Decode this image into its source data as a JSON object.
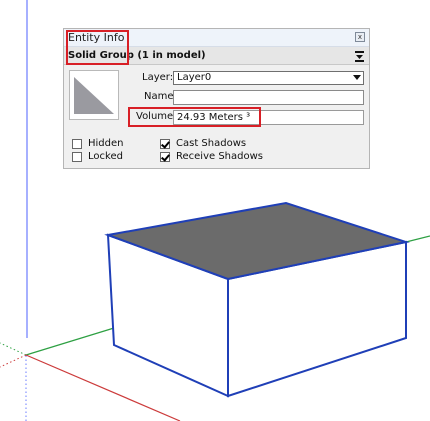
{
  "panel": {
    "title": "Entity Info",
    "entity_type": "Solid Group",
    "entity_count": " (1 in model)",
    "layer_label": "Layer:",
    "layer_value": "Layer0",
    "name_label": "Name:",
    "name_value": "",
    "volume_label": "Volume:",
    "volume_value": "24.93 Meters ³"
  },
  "checkboxes": {
    "hidden": {
      "label": "Hidden",
      "checked": false
    },
    "locked": {
      "label": "Locked",
      "checked": false
    },
    "cast_shadows": {
      "label": "Cast Shadows",
      "checked": true
    },
    "receive_shadows": {
      "label": "Receive Shadows",
      "checked": true
    }
  },
  "colors": {
    "highlight": "#d81f26",
    "edge_blue": "#1f3fb7",
    "top_face": "#6b6b6b",
    "axis_red": "#cc3b3b",
    "axis_green": "#2ea043",
    "axis_blue": "#6b7cff"
  },
  "icons": {
    "close": "close-icon",
    "toggle": "panel-toggle-icon",
    "dropdown": "chevron-down-icon"
  }
}
